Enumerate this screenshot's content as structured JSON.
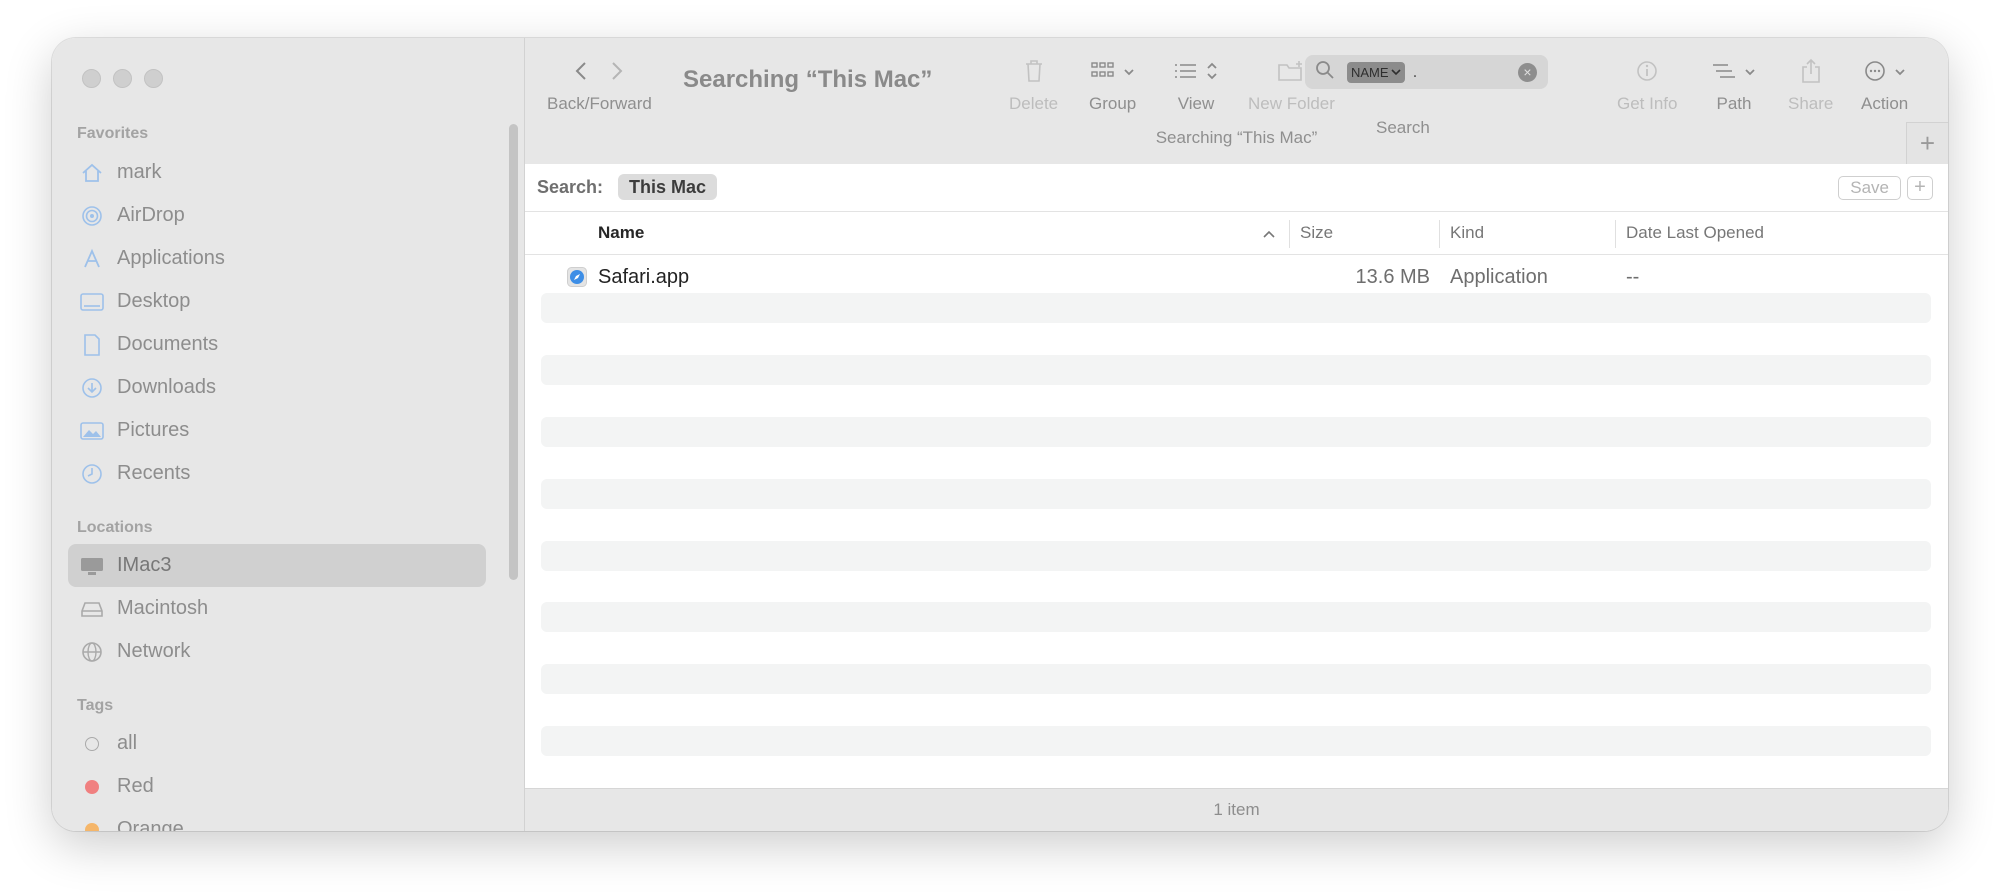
{
  "window": {
    "title": "Searching “This Mac”",
    "tab_title": "Searching “This Mac”"
  },
  "sidebar": {
    "favorites_header": "Favorites",
    "favorites": [
      {
        "label": "mark",
        "icon": "home-icon"
      },
      {
        "label": "AirDrop",
        "icon": "airdrop-icon"
      },
      {
        "label": "Applications",
        "icon": "applications-icon"
      },
      {
        "label": "Desktop",
        "icon": "desktop-icon"
      },
      {
        "label": "Documents",
        "icon": "document-icon"
      },
      {
        "label": "Downloads",
        "icon": "download-icon"
      },
      {
        "label": "Pictures",
        "icon": "pictures-icon"
      },
      {
        "label": "Recents",
        "icon": "clock-icon"
      }
    ],
    "locations_header": "Locations",
    "locations": [
      {
        "label": "IMac3",
        "icon": "computer-icon",
        "selected": true
      },
      {
        "label": "Macintosh",
        "icon": "disk-icon"
      },
      {
        "label": "Network",
        "icon": "globe-icon"
      }
    ],
    "tags_header": "Tags",
    "tags": [
      {
        "label": "all",
        "color": "#ffffff"
      },
      {
        "label": "Red",
        "color": "#f08080"
      },
      {
        "label": "Orange",
        "color": "#f5b66a"
      }
    ]
  },
  "toolbar": {
    "back_forward_label": "Back/Forward",
    "delete_label": "Delete",
    "group_label": "Group",
    "view_label": "View",
    "new_folder_label": "New Folder",
    "search_label": "Search",
    "get_info_label": "Get Info",
    "path_label": "Path",
    "share_label": "Share",
    "action_label": "Action",
    "search_token": "NAME",
    "search_value": "."
  },
  "scope": {
    "label": "Search:",
    "selected": "This Mac",
    "save_label": "Save",
    "add_label": "+"
  },
  "columns": {
    "name": "Name",
    "size": "Size",
    "kind": "Kind",
    "date": "Date Last Opened"
  },
  "files": [
    {
      "name": "Safari.app",
      "size": "13.6 MB",
      "kind": "Application",
      "date_last_opened": "--",
      "icon": "safari-icon"
    }
  ],
  "status": {
    "item_count": "1 item"
  },
  "colors": {
    "accent": "#4a90e2",
    "sidebar_bg": "#e7e7e7",
    "selected_bg": "#d0d0d0"
  }
}
